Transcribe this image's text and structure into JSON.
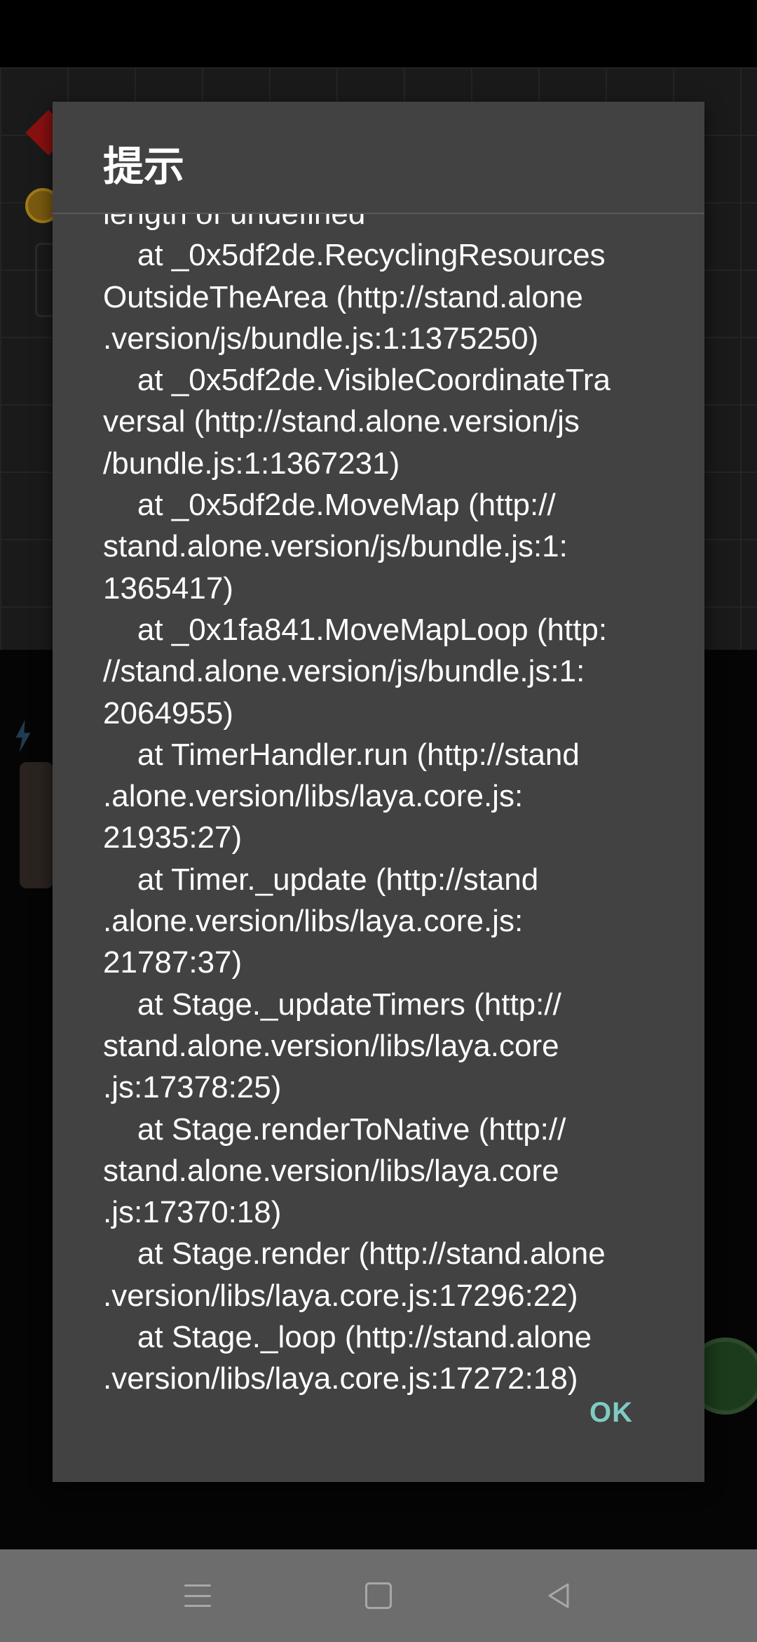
{
  "dialog": {
    "title": "提示",
    "message": "length of undefined\n    at _0x5df2de.RecyclingResources\nOutsideTheArea (http://stand.alone\n.version/js/bundle.js:1:1375250)\n    at _0x5df2de.VisibleCoordinateTra\nversal (http://stand.alone.version/js\n/bundle.js:1:1367231)\n    at _0x5df2de.MoveMap (http://\nstand.alone.version/js/bundle.js:1:\n1365417)\n    at _0x1fa841.MoveMapLoop (http:\n//stand.alone.version/js/bundle.js:1:\n2064955)\n    at TimerHandler.run (http://stand\n.alone.version/libs/laya.core.js:\n21935:27)\n    at Timer._update (http://stand\n.alone.version/libs/laya.core.js:\n21787:37)\n    at Stage._updateTimers (http://\nstand.alone.version/libs/laya.core\n.js:17378:25)\n    at Stage.renderToNative (http://\nstand.alone.version/libs/laya.core\n.js:17370:18)\n    at Stage.render (http://stand.alone\n.version/libs/laya.core.js:17296:22)\n    at Stage._loop (http://stand.alone\n.version/libs/laya.core.js:17272:18)",
    "ok_label": "OK",
    "ok_color": "#80cbc4",
    "background_color": "#424242"
  },
  "navigation_bar": {
    "buttons": [
      {
        "icon": "menu-icon"
      },
      {
        "icon": "home-icon"
      },
      {
        "icon": "back-icon"
      }
    ]
  }
}
